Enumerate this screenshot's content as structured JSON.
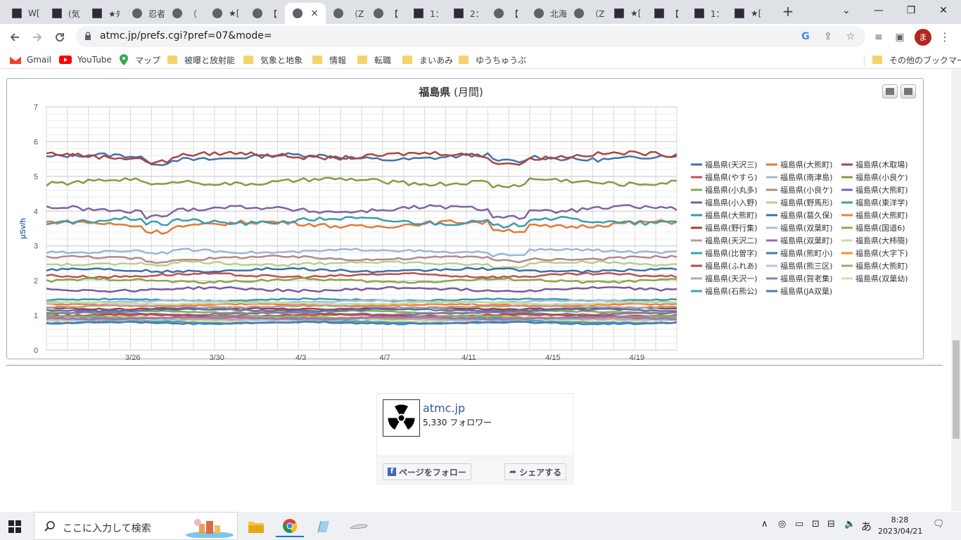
{
  "browser": {
    "tabs": [
      {
        "label": "W["
      },
      {
        "label": "(気"
      },
      {
        "label": "★ﾀ"
      },
      {
        "label": "忍者"
      },
      {
        "label": "（"
      },
      {
        "label": "★["
      },
      {
        "label": "【"
      },
      {
        "label": "",
        "active": true
      },
      {
        "label": "（Z"
      },
      {
        "label": "【"
      },
      {
        "label": "1："
      },
      {
        "label": "2："
      },
      {
        "label": "【"
      },
      {
        "label": "北海"
      },
      {
        "label": "（Z"
      },
      {
        "label": "★["
      },
      {
        "label": "【"
      },
      {
        "label": "1："
      },
      {
        "label": "★["
      }
    ],
    "active_tab_close": "×",
    "new_tab": "+",
    "window_controls": {
      "minimize": "⌄",
      "min": "—",
      "restore": "❐",
      "close": "✕"
    },
    "url": "atmc.jp/prefs.cgi?pref=07&mode=",
    "avatar_letter": "ま",
    "bookmarks": [
      {
        "label": "Gmail",
        "icon": "gmail-icon"
      },
      {
        "label": "YouTube",
        "icon": "youtube-icon"
      },
      {
        "label": "マップ",
        "icon": "maps-icon"
      },
      {
        "label": "被曝と放射能",
        "icon": "folder-icon"
      },
      {
        "label": "気象と地象",
        "icon": "folder-icon"
      },
      {
        "label": "情報",
        "icon": "folder-icon"
      },
      {
        "label": "転職",
        "icon": "folder-icon"
      },
      {
        "label": "まいあみ",
        "icon": "folder-icon"
      },
      {
        "label": "ゆうちゅうぶ",
        "icon": "folder-icon"
      }
    ],
    "other_bookmarks": "その他のブックマーク"
  },
  "chart_data": {
    "type": "line",
    "title_main": "福島県",
    "title_sub": " (月間)",
    "ylabel": "μSv/h",
    "xlabel": "",
    "ylim": [
      0,
      7
    ],
    "yticks": [
      "0",
      "1",
      "2",
      "3",
      "4",
      "5",
      "6",
      "7"
    ],
    "x_ticks": [
      "3/26",
      "3/30",
      "4/3",
      "4/7",
      "4/11",
      "4/15",
      "4/19"
    ],
    "grid": true,
    "legend_position": "right",
    "series": [
      {
        "name": "福島県(天沢三)",
        "color": "#4572a7",
        "level": 5.55
      },
      {
        "name": "福島県(大熊町)",
        "color": "#e07b39",
        "level": 3.62
      },
      {
        "name": "福島県(木取場)",
        "color": "#aa4643",
        "level": 5.6
      },
      {
        "name": "福島県(やすら)",
        "color": "#c0504d",
        "level": 2.15
      },
      {
        "name": "福島県(南津島)",
        "color": "#9fb4d6",
        "level": 2.85
      },
      {
        "name": "福島県(小良ケ)",
        "color": "#7f9f3e",
        "level": 4.85
      },
      {
        "name": "福島県(小丸多)",
        "color": "#8aa64c",
        "level": 2.0
      },
      {
        "name": "福島県(小良ケ)",
        "color": "#b08a8a",
        "level": 2.65
      },
      {
        "name": "福島県(大熊町)",
        "color": "#8064a2",
        "level": 4.05
      },
      {
        "name": "福島県(小入野)",
        "color": "#7a5a9e",
        "level": 1.75
      },
      {
        "name": "福島県(野馬形)",
        "color": "#b8d08a",
        "level": 2.5
      },
      {
        "name": "福島県(東洋学)",
        "color": "#3c9cb0",
        "level": 3.72
      },
      {
        "name": "福島県(大熊町)",
        "color": "#3a9aa6",
        "level": 1.45
      },
      {
        "name": "福島県(葛久保)",
        "color": "#3c6fa8",
        "level": 2.3
      },
      {
        "name": "福島県(大熊町)",
        "color": "#e8843a",
        "level": 1.3
      },
      {
        "name": "福島県(野行集)",
        "color": "#a0403c",
        "level": 1.2
      },
      {
        "name": "福島県(双葉町)",
        "color": "#a9bde0",
        "level": 1.4
      },
      {
        "name": "福島県(国道6)",
        "color": "#90a850",
        "level": 1.1
      },
      {
        "name": "福島県(天沢二)",
        "color": "#c09898",
        "level": 1.25
      },
      {
        "name": "福島県(双葉町)",
        "color": "#9070b0",
        "level": 1.05
      },
      {
        "name": "福島県(大柿簡)",
        "color": "#c8dca0",
        "level": 1.35
      },
      {
        "name": "福島県(比曽字)",
        "color": "#3aa0b8",
        "level": 0.95
      },
      {
        "name": "福島県(熊町小)",
        "color": "#4a78b0",
        "level": 1.15
      },
      {
        "name": "福島県(大字下)",
        "color": "#f09040",
        "level": 0.9
      },
      {
        "name": "福島県(ふれあ)",
        "color": "#b84a46",
        "level": 1.0
      },
      {
        "name": "福島県(熊三区)",
        "color": "#b0c4e4",
        "level": 0.85
      },
      {
        "name": "福島県(大熊町)",
        "color": "#98b058",
        "level": 0.95
      },
      {
        "name": "福島県(天沢一)",
        "color": "#c8a0a0",
        "level": 0.88
      },
      {
        "name": "福島県(賀老集)",
        "color": "#9878b8",
        "level": 0.92
      },
      {
        "name": "福島県(双葉幼)",
        "color": "#d0e4a8",
        "level": 0.82
      },
      {
        "name": "福島県(石熊公)",
        "color": "#40a4bc",
        "level": 0.8
      },
      {
        "name": "福島県(JA双葉)",
        "color": "#4a7cb4",
        "level": 0.78
      }
    ]
  },
  "facebook": {
    "name": "atmc.jp",
    "followers": "5,330 フォロワー",
    "follow_button": "ページをフォロー",
    "share_button": "シェアする"
  },
  "taskbar": {
    "search_placeholder": "ここに入力して検索",
    "time": "8:28",
    "date": "2023/04/21",
    "ime": "あ",
    "tray_chevron": "∧"
  }
}
